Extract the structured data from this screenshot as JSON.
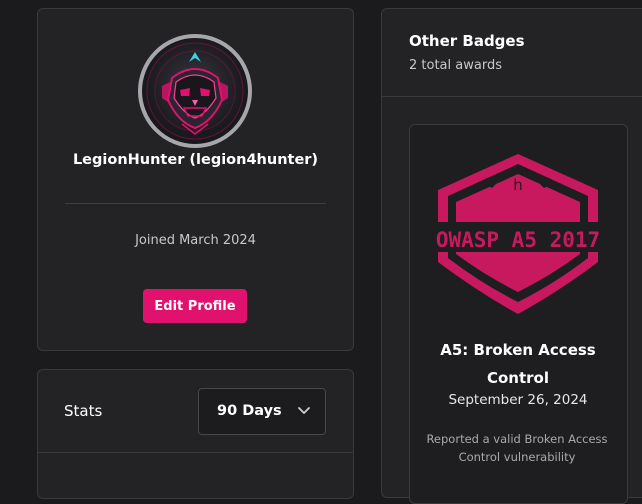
{
  "profile": {
    "display_name": "LegionHunter (legion4hunter)",
    "joined": "Joined March 2024",
    "edit_button_label": "Edit Profile",
    "avatar_icon": "skull-avatar-icon"
  },
  "stats": {
    "title": "Stats",
    "period_selected": "90 Days"
  },
  "badges": {
    "title": "Other Badges",
    "count_text": "2 total awards",
    "items": [
      {
        "emblem_text": "OWASP A5 2017",
        "emblem_logo": "h",
        "name": "A5: Broken Access Control",
        "date": "September 26, 2024",
        "description": "Reported a valid Broken Access Control vulnerability"
      }
    ]
  },
  "colors": {
    "background": "#1b1b1d",
    "card": "#232325",
    "accent": "#e0126e",
    "badge_pink": "#c8195f"
  }
}
